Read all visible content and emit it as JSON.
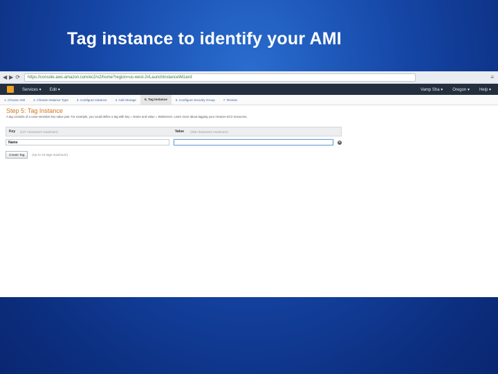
{
  "slide": {
    "title": "Tag instance to identify your AMI"
  },
  "browser": {
    "url": "https://console.aws.amazon.com/ec2/v2/home?region=us-west-2#LaunchInstanceWizard:",
    "nav_glyphs": [
      "◀",
      "▶",
      "⟳"
    ],
    "menu_glyph": "≡"
  },
  "aws": {
    "services_label": "Services ▾",
    "edit_label": "Edit ▾",
    "account_label": "Vamp Sha ▾",
    "region_label": "Oregon ▾",
    "support_label": "Help ▾",
    "brand_color": "#f0a023"
  },
  "wizard": {
    "steps": [
      "1. Choose AMI",
      "2. Choose Instance Type",
      "3. Configure Instance",
      "4. Add Storage",
      "5. Tag Instance",
      "6. Configure Security Group",
      "7. Review"
    ],
    "active_index": 4
  },
  "step": {
    "title": "Step 5: Tag Instance",
    "description": "A tag consists of a case-sensitive key-value pair. For example, you could define a tag with key = Name and value = Webserver. Learn more about tagging your Amazon EC2 resources."
  },
  "tags": {
    "key_header": "Key",
    "key_hint": "(127 characters maximum)",
    "value_header": "Value",
    "value_hint": "(255 characters maximum)",
    "rows": [
      {
        "key": "Name",
        "value": ""
      }
    ],
    "remove_glyph": "✕",
    "create_label": "Create Tag",
    "limit_hint": "(Up to 10 tags maximum)"
  }
}
